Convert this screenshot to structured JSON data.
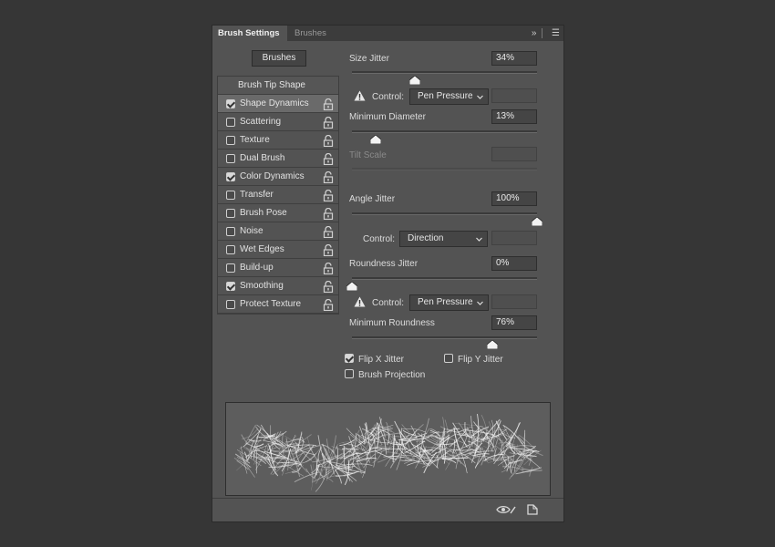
{
  "tabs": [
    {
      "label": "Brush Settings"
    },
    {
      "label": "Brushes"
    }
  ],
  "icons": {
    "collapse": "double-chevron-right-icon",
    "menu": "hamburger-menu-icon",
    "lock": "lock-icon",
    "warning": "warning-icon",
    "toggle_preview": "eye-brush-icon",
    "new_preset": "new-preset-icon"
  },
  "brushes_button": "Brushes",
  "sidebar": {
    "header": "Brush Tip Shape",
    "items": [
      {
        "label": "Shape Dynamics",
        "checked": true,
        "selected": true
      },
      {
        "label": "Scattering",
        "checked": false
      },
      {
        "label": "Texture",
        "checked": false
      },
      {
        "label": "Dual Brush",
        "checked": false
      },
      {
        "label": "Color Dynamics",
        "checked": true
      },
      {
        "label": "Transfer",
        "checked": false
      },
      {
        "label": "Brush Pose",
        "checked": false
      },
      {
        "label": "Noise",
        "checked": false
      },
      {
        "label": "Wet Edges",
        "checked": false
      },
      {
        "label": "Build-up",
        "checked": false
      },
      {
        "label": "Smoothing",
        "checked": true
      },
      {
        "label": "Protect Texture",
        "checked": false
      }
    ]
  },
  "controls": {
    "size_jitter": {
      "label": "Size Jitter",
      "value": "34%",
      "level": 0.34
    },
    "size_control": {
      "label": "Control:",
      "value": "Pen Pressure"
    },
    "min_diameter": {
      "label": "Minimum Diameter",
      "value": "13%",
      "level": 0.13
    },
    "tilt_scale": {
      "label": "Tilt Scale",
      "value": ""
    },
    "angle_jitter": {
      "label": "Angle Jitter",
      "value": "100%",
      "level": 1.0
    },
    "angle_control": {
      "label": "Control:",
      "value": "Direction"
    },
    "roundness_jitter": {
      "label": "Roundness Jitter",
      "value": "0%",
      "level": 0.0
    },
    "roundness_control": {
      "label": "Control:",
      "value": "Pen Pressure"
    },
    "min_roundness": {
      "label": "Minimum Roundness",
      "value": "76%",
      "level": 0.76
    }
  },
  "checkboxes": {
    "flip_x": {
      "label": "Flip X Jitter",
      "checked": true
    },
    "flip_y": {
      "label": "Flip Y Jitter",
      "checked": false
    },
    "brush_projection": {
      "label": "Brush Projection",
      "checked": false
    }
  },
  "colors": {
    "panel_bg": "#535353",
    "app_bg": "#363636",
    "selected_row": "#6a6a6a"
  }
}
